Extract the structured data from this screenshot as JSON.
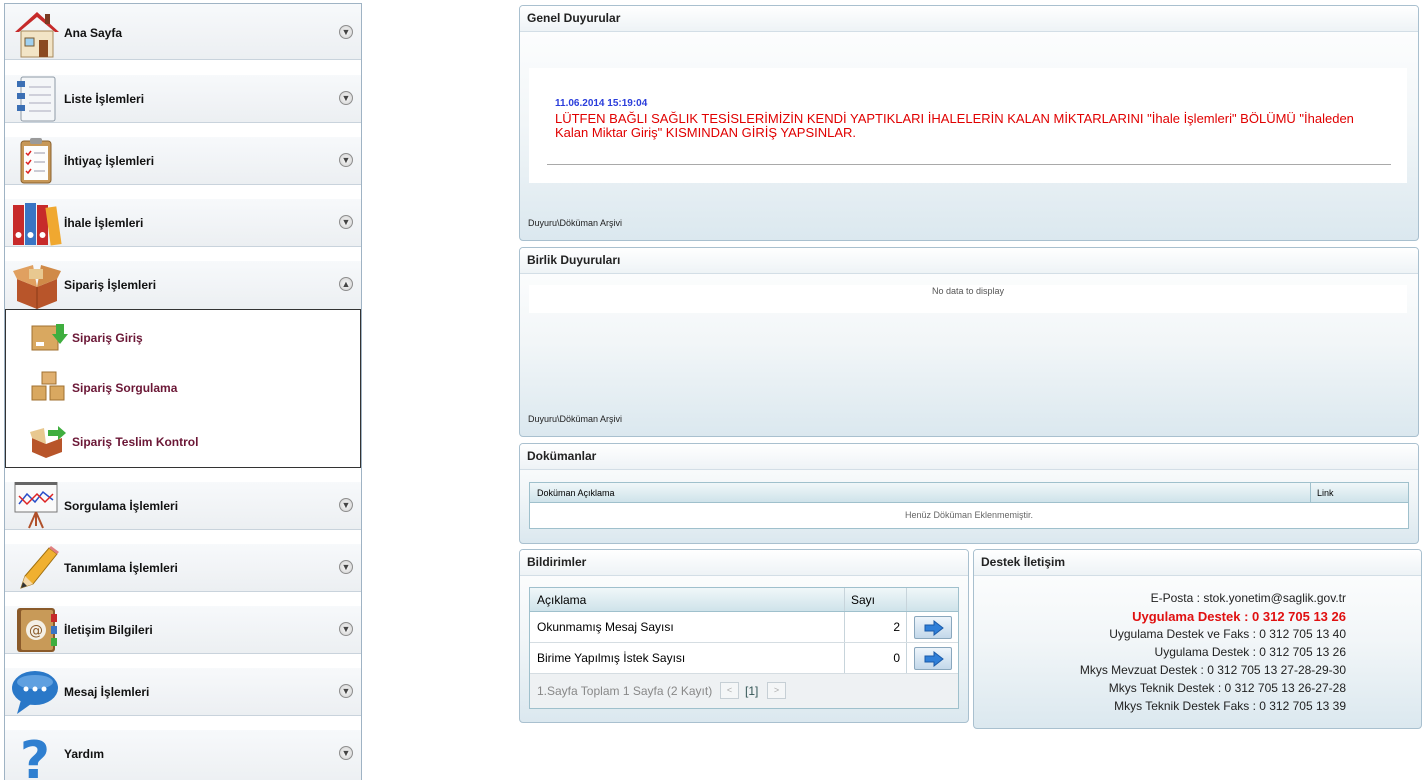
{
  "sidebar": {
    "items": [
      {
        "label": "Ana Sayfa",
        "icon": "house-icon"
      },
      {
        "label": "Liste İşlemleri",
        "icon": "notebook-list-icon"
      },
      {
        "label": "İhtiyaç İşlemleri",
        "icon": "clipboard-checklist-icon"
      },
      {
        "label": "İhale İşlemleri",
        "icon": "binders-icon"
      },
      {
        "label": "Sipariş İşlemleri",
        "icon": "open-box-icon"
      },
      {
        "label": "Sorgulama İşlemleri",
        "icon": "chart-easel-icon"
      },
      {
        "label": "Tanımlama İşlemleri",
        "icon": "pencil-icon"
      },
      {
        "label": "İletişim Bilgileri",
        "icon": "address-book-icon"
      },
      {
        "label": "Mesaj İşlemleri",
        "icon": "speech-bubble-icon"
      },
      {
        "label": "Yardım",
        "icon": "question-mark-icon"
      }
    ],
    "expanded_index": 4,
    "submenu": [
      {
        "label": "Sipariş Giriş",
        "icon": "box-down-arrow-icon"
      },
      {
        "label": "Sipariş Sorgulama",
        "icon": "stacked-boxes-icon"
      },
      {
        "label": "Sipariş Teslim Kontrol",
        "icon": "box-right-arrow-icon"
      }
    ]
  },
  "genel": {
    "title": "Genel Duyurular",
    "date": "11.06.2014 15:19:04",
    "message": "LÜTFEN BAĞLI SAĞLIK TESİSLERİMİZİN KENDİ YAPTIKLARI İHALELERİN KALAN MİKTARLARINI \"İhale İşlemleri\" BÖLÜMÜ \"İhaleden Kalan Miktar Giriş\" KISMINDAN GİRİŞ YAPSINLAR.",
    "archive": "Duyuru\\Döküman Arşivi"
  },
  "birlik": {
    "title": "Birlik Duyuruları",
    "empty": "No data to display",
    "archive": "Duyuru\\Döküman Arşivi"
  },
  "dokumanlar": {
    "title": "Dokümanlar",
    "col_desc": "Doküman Açıklama",
    "col_link": "Link",
    "empty": "Henüz Döküman Eklenmemiştir."
  },
  "bildirimler": {
    "title": "Bildirimler",
    "col_desc": "Açıklama",
    "col_count": "Sayı",
    "rows": [
      {
        "label": "Okunmamış Mesaj Sayısı",
        "count": "2"
      },
      {
        "label": "Birime Yapılmış İstek Sayısı",
        "count": "0"
      }
    ],
    "pager_text": "1.Sayfa Toplam 1 Sayfa (2 Kayıt)",
    "current_page": "[1]",
    "prev": "<",
    "next": ">"
  },
  "destek": {
    "title": "Destek İletişim",
    "lines": [
      "E-Posta : stok.yonetim@saglik.gov.tr",
      "Uygulama Destek : 0 312 705 13 26",
      "Uygulama Destek ve Faks : 0 312 705 13 40",
      "Uygulama Destek : 0 312 705 13 26",
      "Mkys Mevzuat Destek : 0 312 705 13 27-28-29-30",
      "Mkys Teknik Destek : 0 312 705 13 26-27-28",
      "Mkys Teknik Destek Faks : 0 312 705 13 39"
    ],
    "highlight_color": "#e01010"
  },
  "colors": {
    "notice_red": "#e00000",
    "date_blue": "#2a3ddb",
    "submenu_text": "#6b1736",
    "panel_border": "#a9c0cf"
  }
}
